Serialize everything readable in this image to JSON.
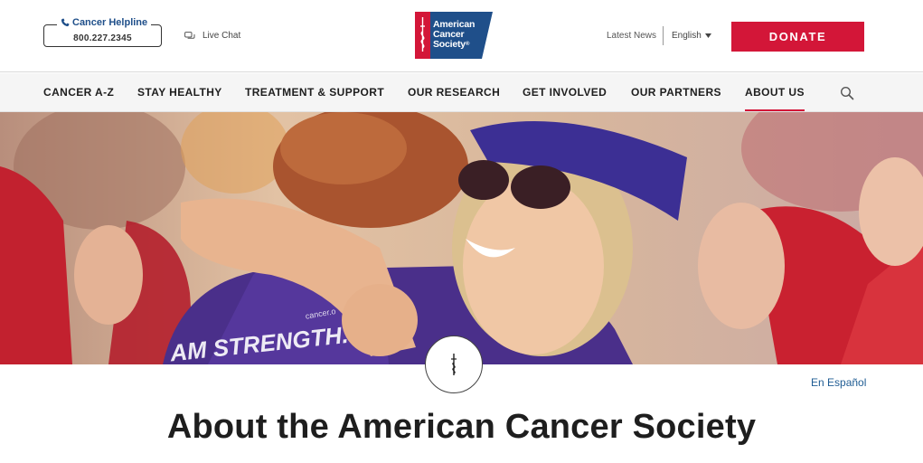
{
  "header": {
    "helpline_label": "Cancer Helpline",
    "helpline_number": "800.227.2345",
    "live_chat": "Live Chat",
    "logo_text": [
      "American",
      "Cancer",
      "Society"
    ],
    "logo_registered": "®",
    "latest_news": "Latest News",
    "language": "English",
    "donate": "DONATE"
  },
  "nav": {
    "items": [
      {
        "label": "CANCER A-Z"
      },
      {
        "label": "STAY HEALTHY"
      },
      {
        "label": "TREATMENT & SUPPORT"
      },
      {
        "label": "OUR RESEARCH"
      },
      {
        "label": "GET INVOLVED"
      },
      {
        "label": "OUR PARTNERS"
      },
      {
        "label": "ABOUT US",
        "active": true
      }
    ]
  },
  "hero": {
    "shirt_text": "AM STRENGTH.",
    "shirt_small": "cancer.o"
  },
  "main": {
    "espanol_link": "En Español",
    "title": "About the American Cancer Society"
  },
  "colors": {
    "brand_red": "#d31638",
    "brand_blue": "#1f4f8a",
    "link_blue": "#1f5c93"
  },
  "icons": {
    "phone": "phone-icon",
    "chat": "chat-icon",
    "dropdown": "caret-down-icon",
    "search": "search-icon",
    "emblem": "sword-emblem-icon"
  }
}
